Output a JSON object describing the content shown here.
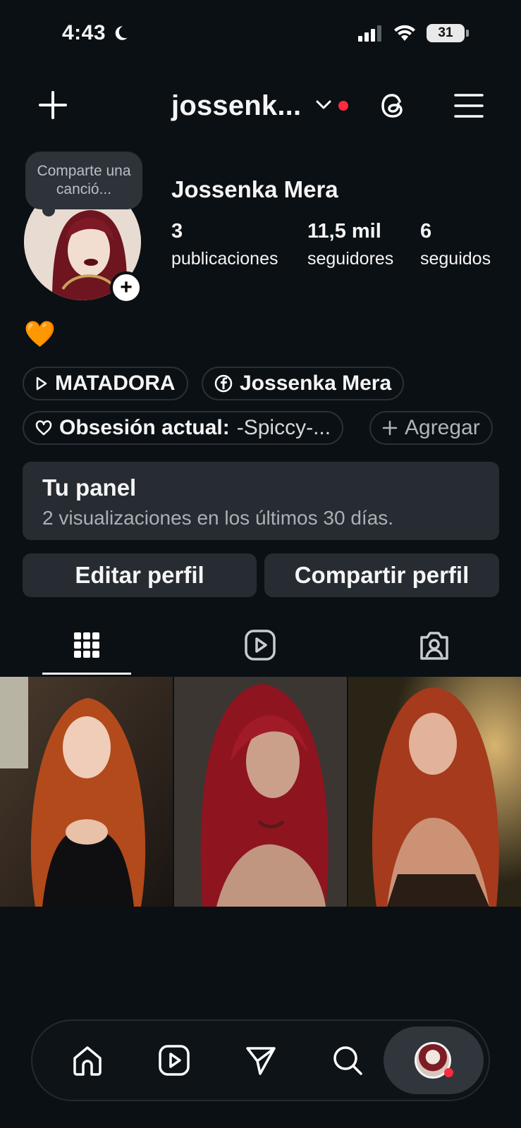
{
  "status_bar": {
    "time": "4:43",
    "battery": "31"
  },
  "header": {
    "username": "jossenk..."
  },
  "profile": {
    "note_bubble": "Comparte una canció...",
    "full_name": "Jossenka Mera",
    "stats": [
      {
        "value": "3",
        "label": "publicaciones"
      },
      {
        "value": "11,5 mil",
        "label": "seguidores"
      },
      {
        "value": "6",
        "label": "seguidos"
      }
    ],
    "bio_emoji": "🧡"
  },
  "chips": {
    "music": "MATADORA",
    "facebook": "Jossenka Mera",
    "obsession_label": "Obsesión actual:",
    "obsession_value": "-Spiccy-...",
    "add": "Agregar"
  },
  "panel": {
    "title": "Tu panel",
    "subtitle": "2 visualizaciones en los últimos 30 días."
  },
  "buttons": {
    "edit": "Editar perfil",
    "share": "Compartir perfil"
  },
  "tabs": [
    {
      "icon": "grid-icon",
      "active": true
    },
    {
      "icon": "reels-icon",
      "active": false
    },
    {
      "icon": "tagged-icon",
      "active": false
    }
  ],
  "posts_count": 3,
  "bottom_nav": [
    "home-icon",
    "reels-icon",
    "send-icon",
    "search-icon",
    "profile-avatar"
  ],
  "colors": {
    "background": "#0b1014",
    "surface": "#262c31",
    "notification": "#ff2a3d",
    "heart": "#f28a1e"
  }
}
